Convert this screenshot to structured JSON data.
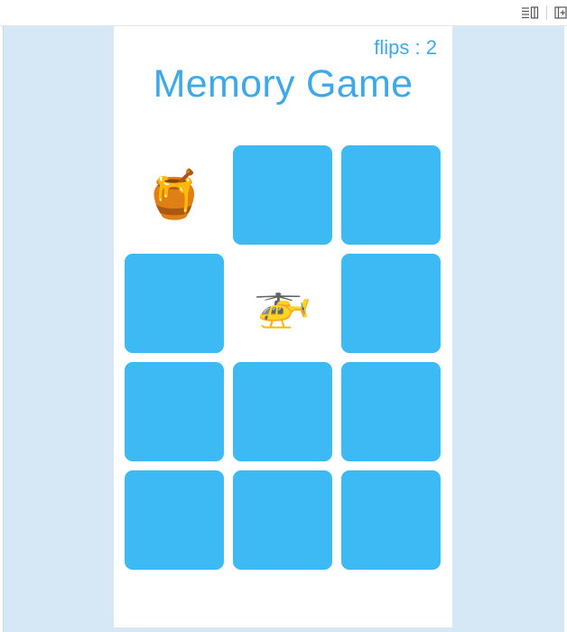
{
  "toolbar": {
    "items": [
      {
        "name": "reader-view-icon"
      },
      {
        "name": "add-panel-icon"
      }
    ]
  },
  "game": {
    "flips_label": "flips",
    "flips_separator": " : ",
    "flips_count": "2",
    "title": "Memory Game"
  },
  "cards": [
    {
      "state": "up",
      "face": "🍯",
      "icon": "honey-pot-icon"
    },
    {
      "state": "down",
      "face": "",
      "icon": ""
    },
    {
      "state": "down",
      "face": "",
      "icon": ""
    },
    {
      "state": "down",
      "face": "",
      "icon": ""
    },
    {
      "state": "up",
      "face": "🚁",
      "icon": "helicopter-icon"
    },
    {
      "state": "down",
      "face": "",
      "icon": ""
    },
    {
      "state": "down",
      "face": "",
      "icon": ""
    },
    {
      "state": "down",
      "face": "",
      "icon": ""
    },
    {
      "state": "down",
      "face": "",
      "icon": ""
    },
    {
      "state": "down",
      "face": "",
      "icon": ""
    },
    {
      "state": "down",
      "face": "",
      "icon": ""
    },
    {
      "state": "down",
      "face": "",
      "icon": ""
    }
  ],
  "colors": {
    "accent": "#3fa9e8",
    "card_back": "#3db9f3",
    "background": "#d6e7f5"
  }
}
